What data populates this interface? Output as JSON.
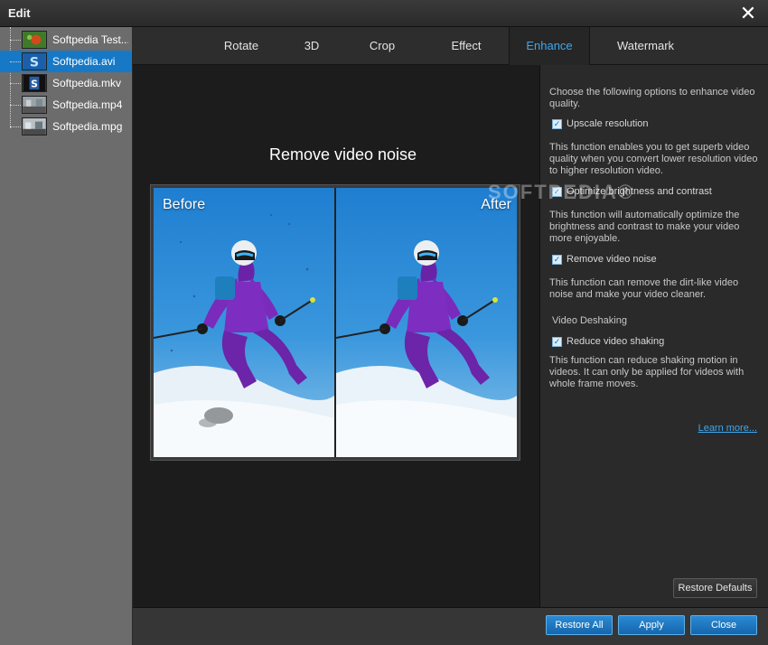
{
  "window": {
    "title": "Edit"
  },
  "files": [
    {
      "name": "Softpedia Test...",
      "selected": false
    },
    {
      "name": "Softpedia.avi",
      "selected": true
    },
    {
      "name": "Softpedia.mkv",
      "selected": false
    },
    {
      "name": "Softpedia.mp4",
      "selected": false
    },
    {
      "name": "Softpedia.mpg",
      "selected": false
    }
  ],
  "tabs": [
    "Rotate",
    "3D",
    "Crop",
    "Effect",
    "Enhance",
    "Watermark"
  ],
  "active_tab": "Enhance",
  "preview": {
    "title": "Remove video noise",
    "before_label": "Before",
    "after_label": "After"
  },
  "options": {
    "intro": "Choose the following options to enhance video quality.",
    "upscale": {
      "label": "Upscale resolution",
      "checked": true,
      "desc": "This function enables you to get superb video quality when you convert lower resolution video to higher resolution video."
    },
    "brightness": {
      "label": "Optimize brightness and contrast",
      "checked": true,
      "desc": "This function will automatically optimize the brightness and contrast to make your video more enjoyable."
    },
    "noise": {
      "label": "Remove video noise",
      "checked": true,
      "desc": "This function can remove the dirt-like video noise and make your video cleaner."
    },
    "deshake_header": "Video Deshaking",
    "deshake": {
      "label": "Reduce video shaking",
      "checked": true,
      "desc": "This function can reduce shaking motion in videos. It can only be applied for videos with whole frame moves."
    },
    "learn_more": "Learn more...",
    "restore_defaults": "Restore Defaults"
  },
  "buttons": {
    "restore_all": "Restore All",
    "apply": "Apply",
    "close": "Close"
  },
  "watermark": "SOFTPEDIA®",
  "colors": {
    "accent": "#3ea8ef",
    "selection": "#1779c6",
    "button_blue": "#1a72bc"
  }
}
